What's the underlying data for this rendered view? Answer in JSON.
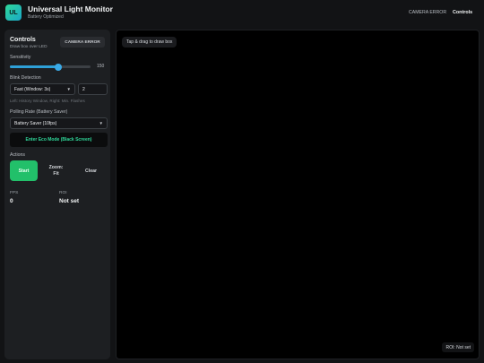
{
  "header": {
    "logo_text": "UL",
    "title": "Universal Light Monitor",
    "subtitle": "Battery Optimized",
    "nav": [
      {
        "label": "CAMERA ERROR"
      },
      {
        "label": "Controls"
      }
    ]
  },
  "controls": {
    "title": "Controls",
    "subtitle": "Draw box over LED",
    "camera_status": "CAMERA ERROR",
    "sensitivity": {
      "label": "Sensitivity",
      "value": 150,
      "value_text": "150",
      "fraction": 0.6
    },
    "blink_detection": {
      "label": "Blink Detection",
      "mode_selected": "Fast (Window: 3s)",
      "flashes_value": "2",
      "hint": "Left: History Window, Right: Min. Flashes"
    },
    "polling": {
      "label": "Polling Rate (Battery Saver)",
      "selected": "Battery Saver (10fps)"
    },
    "eco_button": "Enter Eco Mode (Black Screen)",
    "actions": {
      "label": "Actions",
      "start": "Start",
      "zoom_line1": "Zoom:",
      "zoom_line2": "Fit",
      "clear": "Clear"
    },
    "stats": {
      "fps_label": "FPS",
      "fps_value": "0",
      "roi_label": "ROI",
      "roi_value": "Not set"
    }
  },
  "video": {
    "hint": "Tap & drag to draw box",
    "roi_status": "ROI: Not set"
  },
  "colors": {
    "accent_green": "#22c06a",
    "accent_blue": "#2ea0d8",
    "eco_text": "#2fd89a"
  }
}
